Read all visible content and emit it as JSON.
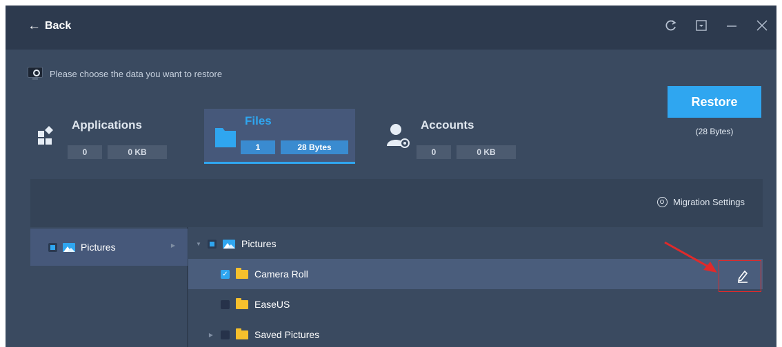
{
  "titlebar": {
    "back_label": "Back",
    "icons": [
      "back-arrow-icon",
      "refresh-icon",
      "dropdown-box-icon",
      "minimize-icon",
      "close-icon"
    ]
  },
  "prompt": {
    "text": "Please choose the data you want to restore",
    "icon": "monitor-icon"
  },
  "categories": [
    {
      "title": "Applications",
      "count": "0",
      "size": "0 KB",
      "icon": "apps-icon",
      "active": false
    },
    {
      "title": "Files",
      "count": "1",
      "size": "28 Bytes",
      "icon": "folder-icon",
      "active": true
    },
    {
      "title": "Accounts",
      "count": "0",
      "size": "0 KB",
      "icon": "account-gear-icon",
      "active": false
    }
  ],
  "restore": {
    "button_label": "Restore",
    "size_text": "(28 Bytes)"
  },
  "panel": {
    "migration_settings_label": "Migration Settings",
    "left_items": [
      {
        "label": "Pictures",
        "checkbox": "partial"
      }
    ],
    "tree": [
      {
        "label": "Pictures",
        "checkbox": "partial",
        "icon": "pictures-icon",
        "expanded": true
      },
      {
        "label": "Camera Roll",
        "checkbox": "checked",
        "icon": "folder-icon",
        "selected": true
      },
      {
        "label": "EaseUS",
        "checkbox": "empty",
        "icon": "folder-icon"
      },
      {
        "label": "Saved Pictures",
        "checkbox": "empty",
        "icon": "folder-icon",
        "collapsed": true
      }
    ]
  },
  "colors": {
    "accent": "#2fa6f0",
    "titlebar": "#2d3a4e",
    "background": "#3a4a60",
    "panel": "#344357",
    "highlight_box": "#e02a2a",
    "folder": "#f6c02d"
  }
}
